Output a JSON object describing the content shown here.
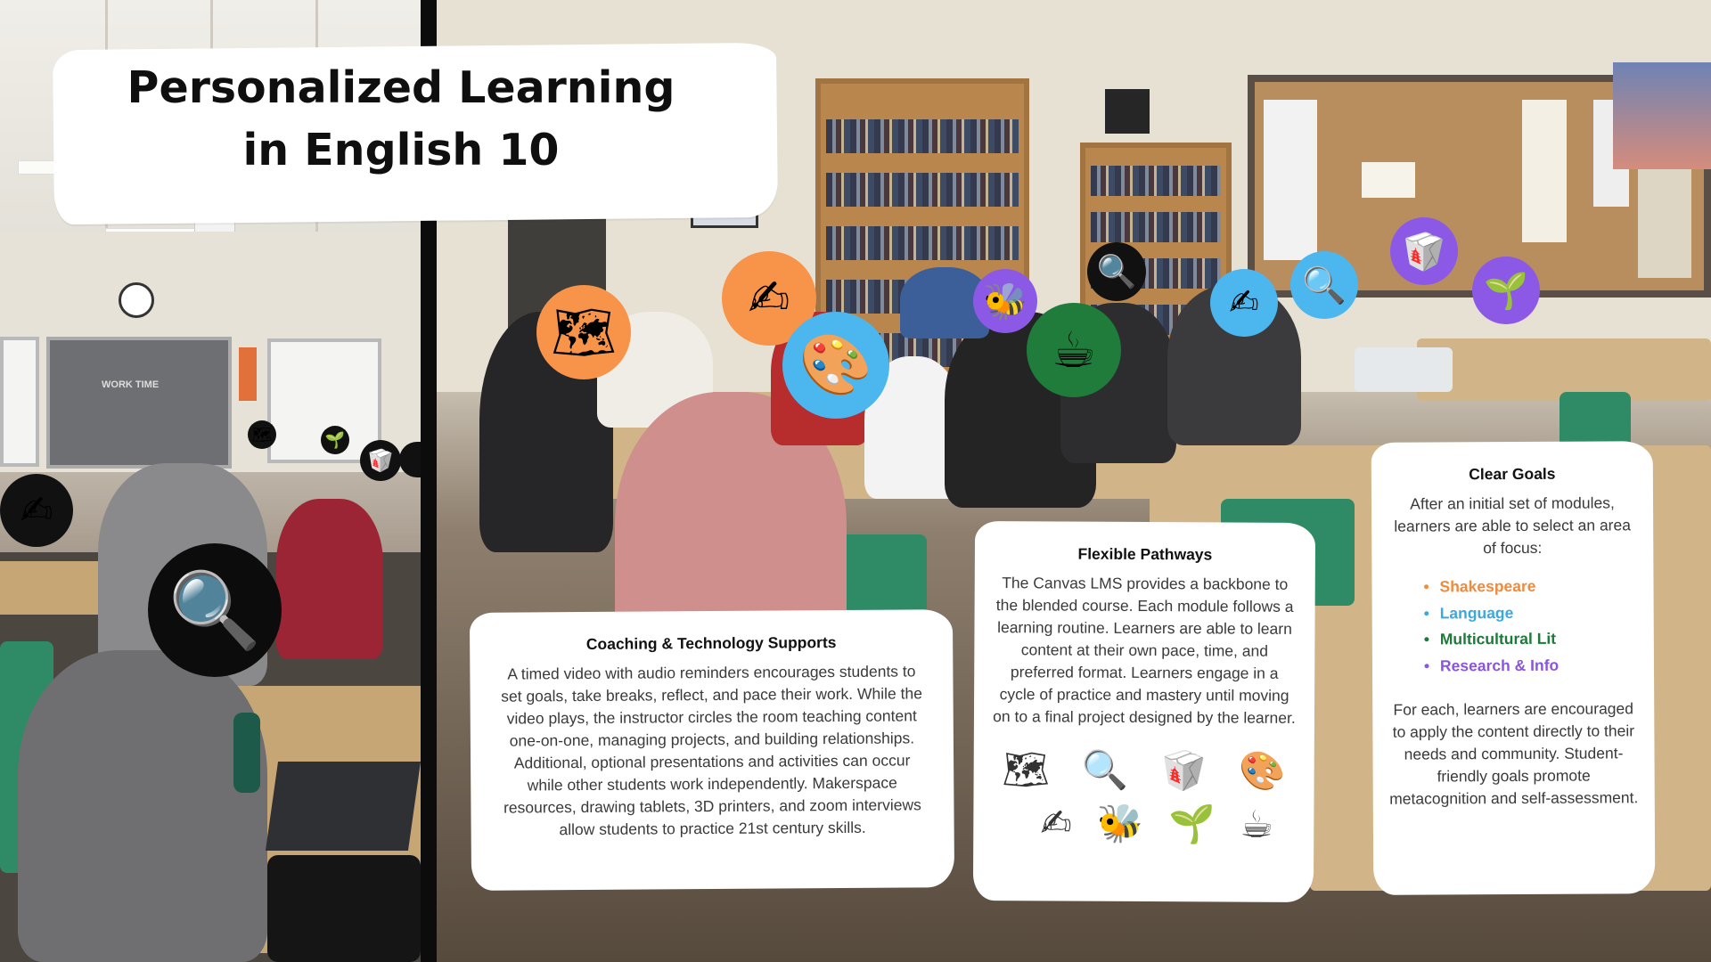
{
  "title": {
    "line1": "Personalized Learning",
    "line2": "in English 10"
  },
  "left_photo": {
    "screen_text": "WORK TIME"
  },
  "cards": {
    "coaching": {
      "heading": "Coaching & Technology Supports",
      "body": "A timed video with audio reminders encourages students to set goals, take breaks, reflect, and pace their work. While the video plays, the instructor circles the room teaching content one-on-one, managing projects, and building relationships. Additional, optional presentations and activities can occur while other students work independently. Makerspace resources, drawing tablets, 3D printers, and zoom interviews allow students to practice 21st century skills."
    },
    "flexible": {
      "heading": "Flexible Pathways",
      "body": "The Canvas LMS provides a backbone to the blended course. Each module follows a learning routine. Learners are able to learn content at their own pace, time, and preferred format. Learners engage in a cycle of practice and mastery until moving on to a final project designed by the learner.",
      "icons_row1": [
        "map-icon",
        "magnifier-icon",
        "takeout-box-icon",
        "palette-icon"
      ],
      "icons_row2": [
        "writing-hand-icon",
        "bee-icon",
        "seedling-icon",
        "coffee-icon"
      ]
    },
    "goals": {
      "heading": "Clear Goals",
      "intro": "After an initial set of modules, learners are able to select an area of focus:",
      "focus": [
        {
          "label": "Shakespeare",
          "color": "#f28a3c"
        },
        {
          "label": "Language",
          "color": "#3ba9e0"
        },
        {
          "label": "Multicultural Lit",
          "color": "#1d7a3a"
        },
        {
          "label": "Research & Info",
          "color": "#8a55e0"
        }
      ],
      "outro": "For each, learners are encouraged to apply the content directly to their needs and community. Student-friendly goals promote metacognition and self-assessment."
    }
  },
  "colors": {
    "orange": "#f7944a",
    "blue": "#4cb6ef",
    "green": "#1f7c3a",
    "purple": "#8c59e6",
    "black": "#111111"
  }
}
